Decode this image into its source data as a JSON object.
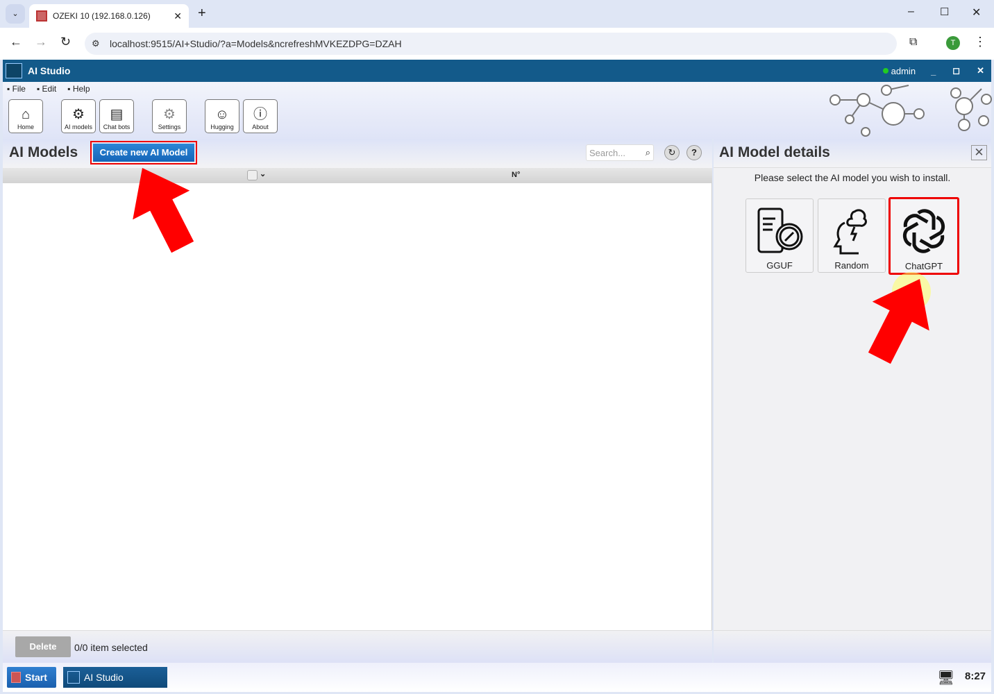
{
  "browser": {
    "tab_title": "OZEKI 10 (192.168.0.126)",
    "url": "localhost:9515/AI+Studio/?a=Models&ncrefreshMVKEZDPG=DZAH",
    "profile_initial": "T"
  },
  "app": {
    "title": "AI Studio",
    "user": "admin",
    "accent": "#135a8a"
  },
  "menu": [
    "File",
    "Edit",
    "Help"
  ],
  "toolbar": [
    {
      "label": "Home",
      "icon": "home-icon"
    },
    {
      "label": "AI models",
      "icon": "ai-models-icon"
    },
    {
      "label": "Chat bots",
      "icon": "chat-bots-icon"
    },
    {
      "label": "Settings",
      "icon": "gear-icon"
    },
    {
      "label": "Hugging",
      "icon": "hugging-face-icon"
    },
    {
      "label": "About",
      "icon": "info-icon"
    }
  ],
  "left": {
    "title": "AI Models",
    "create_label": "Create new AI Model",
    "search_placeholder": "Search...",
    "column_no": "N°",
    "delete_label": "Delete",
    "selection_status": "0/0 item selected"
  },
  "right": {
    "title": "AI Model details",
    "instruction": "Please select the AI model you wish to install.",
    "models": [
      {
        "label": "GGUF"
      },
      {
        "label": "Random"
      },
      {
        "label": "ChatGPT"
      }
    ]
  },
  "taskbar": {
    "start_label": "Start",
    "app_label": "AI Studio",
    "clock": "8:27"
  }
}
